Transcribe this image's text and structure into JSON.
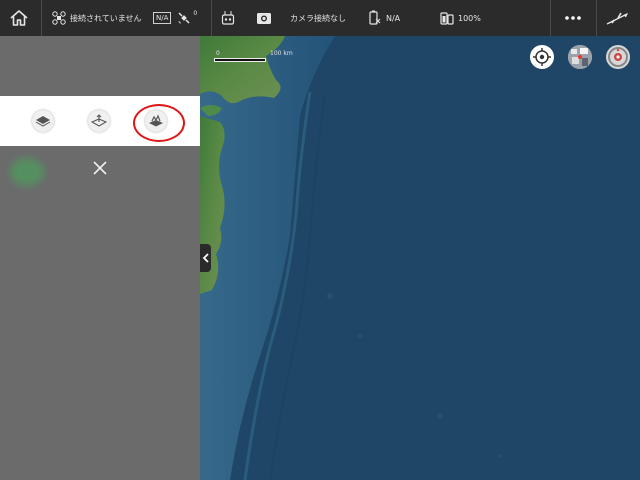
{
  "topbar": {
    "home_icon": "home-icon",
    "drone_status": "接続されていません",
    "gps_value": "N/A",
    "satellite_count": "0",
    "camera_status": "カメラ接続なし",
    "battery_drone": "N/A",
    "battery_remote": "100%",
    "more_icon": "more-icon",
    "takeoff_icon": "takeoff-icon"
  },
  "map": {
    "scale_start": "0",
    "scale_end": "100 km",
    "locate_icon": "locate-icon",
    "thumbnail_icon": "map-thumbnail-icon",
    "compass_icon": "compass-icon"
  },
  "layer_panel": {
    "layers": [
      "map-layer-2d-icon",
      "map-layer-3d-icon",
      "map-layer-terrain-icon"
    ],
    "selected_highlight": "red-circle"
  },
  "colors": {
    "topbar_bg": "#2b2b2b",
    "panel_bg": "#6b6b6b",
    "ocean": "#1f4666",
    "highlight": "#e01414"
  }
}
